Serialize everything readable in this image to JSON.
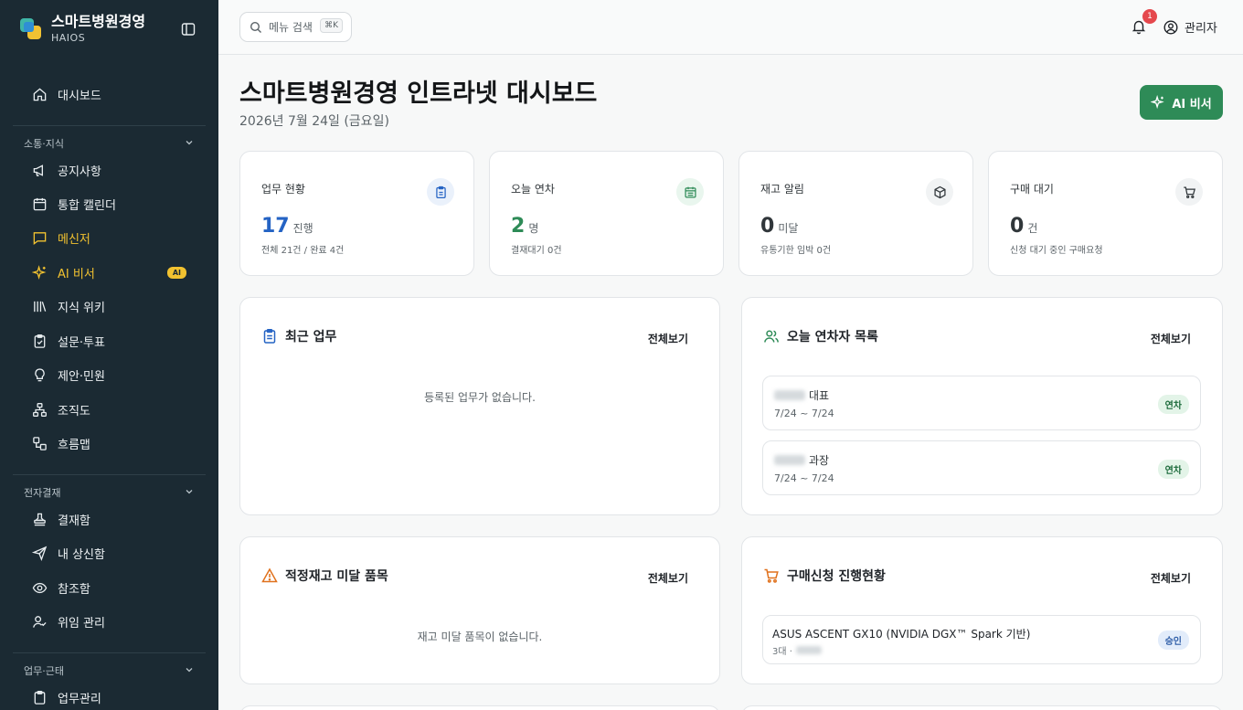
{
  "brand": {
    "title": "스마트병원경영",
    "subtitle": "HAIOS"
  },
  "sidebar": {
    "top_item": "대시보드",
    "sections": [
      {
        "label": "소통·지식"
      },
      {
        "label": "전자결재"
      },
      {
        "label": "업무·근태"
      }
    ],
    "items": [
      {
        "label": "공지사항"
      },
      {
        "label": "통합 캘린더"
      },
      {
        "label": "메신저"
      },
      {
        "label": "AI 비서",
        "badge": "AI"
      },
      {
        "label": "지식 위키"
      },
      {
        "label": "설문·투표"
      },
      {
        "label": "제안·민원"
      },
      {
        "label": "조직도"
      },
      {
        "label": "흐름맵"
      },
      {
        "label": "결재함"
      },
      {
        "label": "내 상신함"
      },
      {
        "label": "참조함"
      },
      {
        "label": "위임 관리"
      },
      {
        "label": "업무관리"
      }
    ],
    "active_item": "메신저",
    "active_color": "#f2c230"
  },
  "topbar": {
    "search_placeholder": "메뉴 검색",
    "search_shortcut": "⌘K",
    "notification_count": "1",
    "user_label": "관리자"
  },
  "page": {
    "title": "스마트병원경영 인트라넷 대시보드",
    "date": "2026년 7월 24일 (금요일)",
    "ai_button": "AI 비서"
  },
  "stats": [
    {
      "label": "업무 현황",
      "value": "17",
      "unit": "진행",
      "sub": "전체 21건 / 완료 4건",
      "color": "#2463c4",
      "icon": "clipboard-icon"
    },
    {
      "label": "오늘 연차",
      "value": "2",
      "unit": "명",
      "sub": "결재대기 0건",
      "color": "#2e8b57",
      "icon": "calendar-icon"
    },
    {
      "label": "재고 알림",
      "value": "0",
      "unit": "미달",
      "sub": "유통기한 임박 0건",
      "color": "#30363a",
      "icon": "box-icon"
    },
    {
      "label": "구매 대기",
      "value": "0",
      "unit": "건",
      "sub": "신청 대기 중인 구매요청",
      "color": "#30363a",
      "icon": "cart-icon"
    }
  ],
  "cards": {
    "recent_tasks": {
      "title": "최근 업무",
      "more": "전체보기",
      "empty": "등록된 업무가 없습니다."
    },
    "leave_today": {
      "title": "오늘 연차자 목록",
      "more": "전체보기",
      "rows": [
        {
          "role": "대표",
          "range": "7/24 ~ 7/24",
          "badge": "연차"
        },
        {
          "role": "과장",
          "range": "7/24 ~ 7/24",
          "badge": "연차"
        }
      ]
    },
    "low_stock": {
      "title": "적정재고 미달 품목",
      "more": "전체보기",
      "empty": "재고 미달 품목이 없습니다."
    },
    "purchase": {
      "title": "구매신청 진행현황",
      "more": "전체보기",
      "rows": [
        {
          "name": "ASUS ASCENT GX10 (NVIDIA DGX™ Spark 기반)",
          "qty": "3대 ·",
          "status": "승인"
        }
      ]
    }
  }
}
